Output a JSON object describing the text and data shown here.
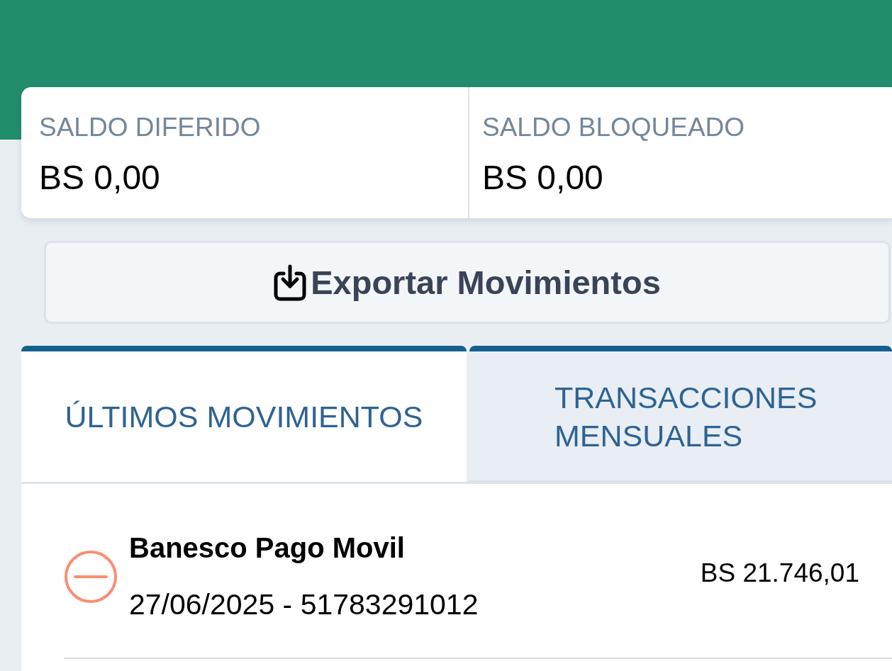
{
  "balances": [
    {
      "label": "SALDO DIFERIDO",
      "amount": "BS 0,00"
    },
    {
      "label": "SALDO BLOQUEADO",
      "amount": "BS 0,00"
    }
  ],
  "export_button": {
    "label": "Exportar Movimientos"
  },
  "tabs": [
    {
      "label": "ÚLTIMOS MOVIMIENTOS",
      "selected": true
    },
    {
      "label": "TRANSACCIONES MENSUALES",
      "selected": false
    }
  ],
  "movements": [
    {
      "kind": "debit",
      "title": "Banesco Pago Movil",
      "details": "27/06/2025 - 51783291012",
      "amount": "BS 21.746,01"
    }
  ]
}
